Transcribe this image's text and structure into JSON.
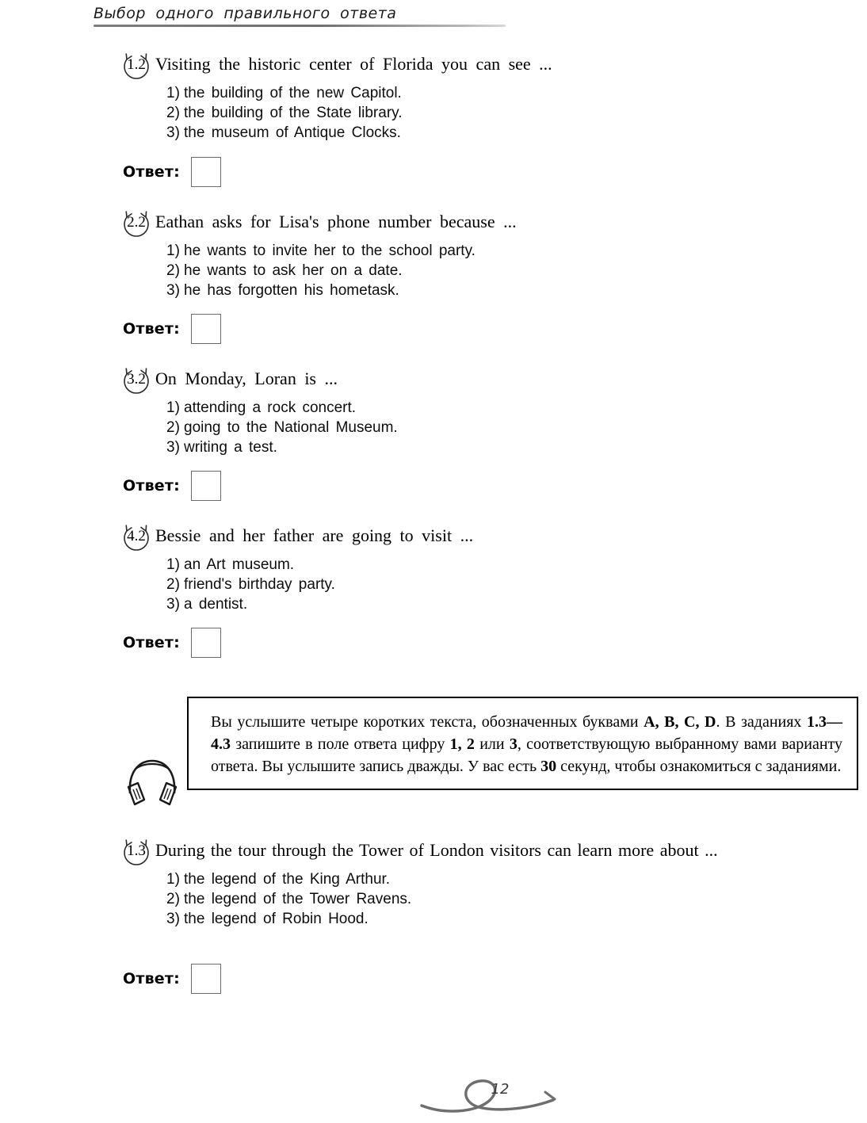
{
  "header": {
    "title": "Выбор одного правильного ответа"
  },
  "answer_label": "Ответ:",
  "questions": [
    {
      "number": "1.2",
      "text": "Visiting the historic center of Florida you can see ...",
      "options": [
        {
          "num": "1)",
          "text": "the building of the new Capitol."
        },
        {
          "num": "2)",
          "text": "the building of the State library."
        },
        {
          "num": "3)",
          "text": "the museum of Antique Clocks."
        }
      ]
    },
    {
      "number": "2.2",
      "text": "Eathan asks for Lisa's phone number because ...",
      "options": [
        {
          "num": "1)",
          "text": "he wants to invite her to the school party."
        },
        {
          "num": "2)",
          "text": "he wants to ask her on a date."
        },
        {
          "num": "3)",
          "text": "he has forgotten his hometask."
        }
      ]
    },
    {
      "number": "3.2",
      "text": "On Monday, Loran is ...",
      "options": [
        {
          "num": "1)",
          "text": "attending a rock concert."
        },
        {
          "num": "2)",
          "text": "going to the National Museum."
        },
        {
          "num": "3)",
          "text": "writing a test."
        }
      ]
    },
    {
      "number": "4.2",
      "text": "Bessie and her father are going to visit ...",
      "options": [
        {
          "num": "1)",
          "text": "an Art museum."
        },
        {
          "num": "2)",
          "text": "friend's birthday party."
        },
        {
          "num": "3)",
          "text": "a dentist."
        }
      ]
    },
    {
      "number": "1.3",
      "text": "During the tour through the Tower of London visitors can learn more about ...",
      "options": [
        {
          "num": "1)",
          "text": "the legend of the King Arthur."
        },
        {
          "num": "2)",
          "text": "the legend of the Tower Ravens."
        },
        {
          "num": "3)",
          "text": "the legend of Robin Hood."
        }
      ]
    }
  ],
  "listening": {
    "icon": "headphones-icon",
    "line1_a": "Вы услышите четыре коротких текста, обозначенных буква­ми ",
    "bold1": "A, B, C, D",
    "line1_b": ". В заданиях ",
    "bold2": "1.3—4.3",
    "line1_c": " запишите в поле ответа цифру ",
    "bold3": "1, 2",
    "line1_d": " или ",
    "bold4": "3",
    "line1_e": ", соответствующую выбранному вами вари­анту ответа. Вы услышите запись дважды. У вас есть ",
    "bold5": "30",
    "line1_f": " се­кунд, чтобы ознакомиться с заданиями."
  },
  "footer": {
    "page_number": "12"
  },
  "colors": {
    "rule": "#6f6f6f",
    "box_border": "#000000",
    "answer_box_border": "#6b6b6b",
    "footer_swirl": "#6e6e6e"
  }
}
